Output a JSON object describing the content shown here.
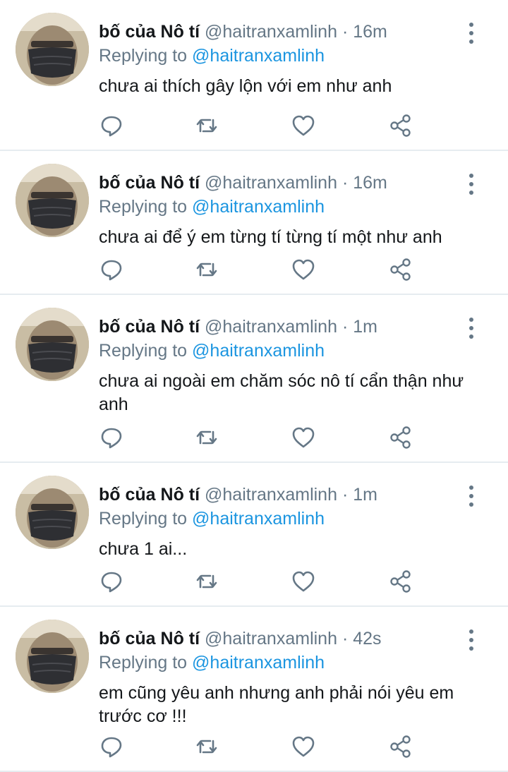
{
  "colors": {
    "name": "#14171a",
    "meta": "#657786",
    "link": "#1b95e0",
    "divider": "#e6ecf0"
  },
  "tweets": [
    {
      "name": "bố của Nô tí",
      "handle": "@haitranxamlinh",
      "time": "16m",
      "replying_label": "Replying to",
      "replying_handle": "@haitranxamlinh",
      "text": "chưa ai thích gây lộn với em như anh"
    },
    {
      "name": "bố của Nô tí",
      "handle": "@haitranxamlinh",
      "time": "16m",
      "replying_label": "Replying to",
      "replying_handle": "@haitranxamlinh",
      "text": "chưa ai để ý em từng tí từng tí một như anh"
    },
    {
      "name": "bố của Nô tí",
      "handle": "@haitranxamlinh",
      "time": "1m",
      "replying_label": "Replying to",
      "replying_handle": "@haitranxamlinh",
      "text": "chưa ai ngoài em chăm sóc nô tí cẩn thận như anh"
    },
    {
      "name": "bố của Nô tí",
      "handle": "@haitranxamlinh",
      "time": "1m",
      "replying_label": "Replying to",
      "replying_handle": "@haitranxamlinh",
      "text": "chưa 1 ai..."
    },
    {
      "name": "bố của Nô tí",
      "handle": "@haitranxamlinh",
      "time": "42s",
      "replying_label": "Replying to",
      "replying_handle": "@haitranxamlinh",
      "text": "em cũng yêu anh nhưng anh phải nói yêu em trước cơ !!!"
    }
  ],
  "icons": {
    "reply": "reply-icon",
    "retweet": "retweet-icon",
    "like": "heart-icon",
    "share": "share-icon",
    "more": "more-vertical-icon"
  }
}
